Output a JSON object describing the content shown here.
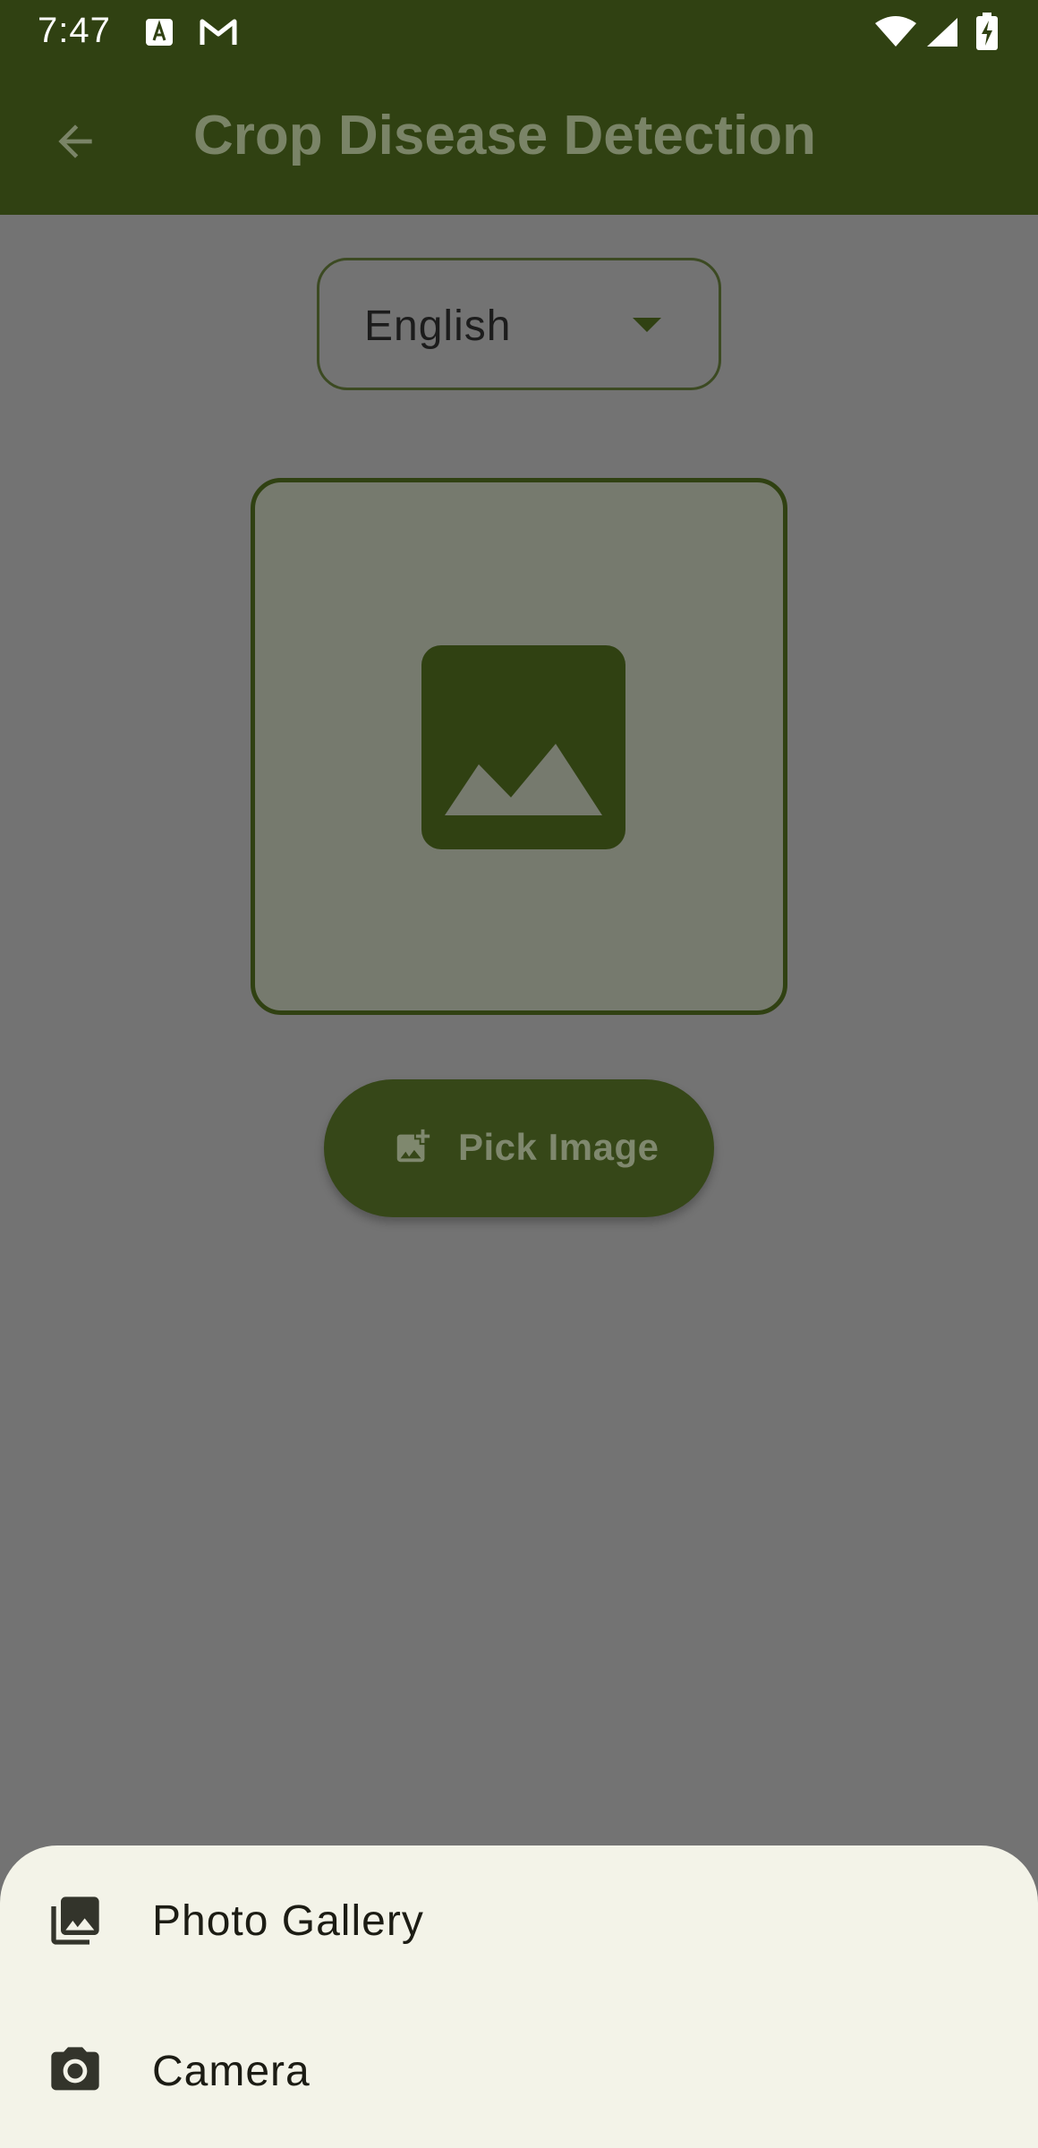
{
  "status_bar": {
    "time": "7:47",
    "icons": [
      "accessibility-a-icon",
      "gmail-icon",
      "wifi-icon",
      "cellular-signal-icon",
      "battery-charging-icon"
    ]
  },
  "app_bar": {
    "title": "Crop Disease Detection",
    "back_icon": "arrow-back-icon"
  },
  "language_selector": {
    "selected": "English"
  },
  "image_preview": {
    "icon": "image-placeholder-icon"
  },
  "pick_button": {
    "label": "Pick Image",
    "icon": "add-photo-icon"
  },
  "bottom_sheet": {
    "options": [
      {
        "label": "Photo Gallery",
        "icon": "photo-library-icon"
      },
      {
        "label": "Camera",
        "icon": "camera-icon"
      }
    ]
  },
  "colors": {
    "primary": "#304112",
    "scrim": "#737373",
    "sheet": "#f3f3e8"
  }
}
